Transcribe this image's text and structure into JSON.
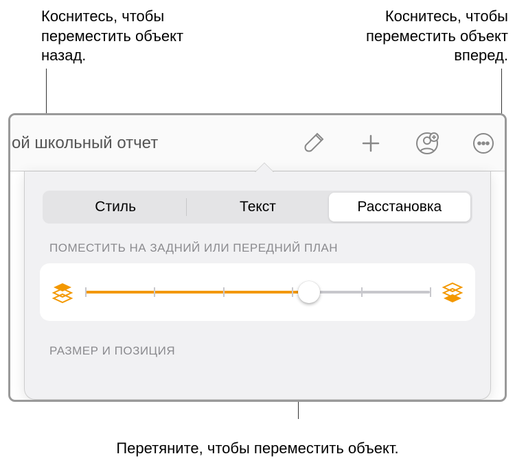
{
  "callouts": {
    "back": "Коснитесь, чтобы переместить объект назад.",
    "forward": "Коснитесь, чтобы переместить объект вперед.",
    "drag": "Перетяните, чтобы переместить объект."
  },
  "toolbar": {
    "title": "ой школьный отчет"
  },
  "tabs": {
    "style": "Стиль",
    "text": "Текст",
    "arrange": "Расстановка",
    "selected": "arrange"
  },
  "sections": {
    "layer_label": "ПОМЕСТИТЬ НА ЗАДНИЙ ИЛИ ПЕРЕДНИЙ ПЛАН",
    "size_pos_label": "РАЗМЕР И ПОЗИЦИЯ"
  },
  "slider": {
    "value_percent": 65,
    "ticks": 6
  },
  "colors": {
    "accent": "#f39800"
  }
}
